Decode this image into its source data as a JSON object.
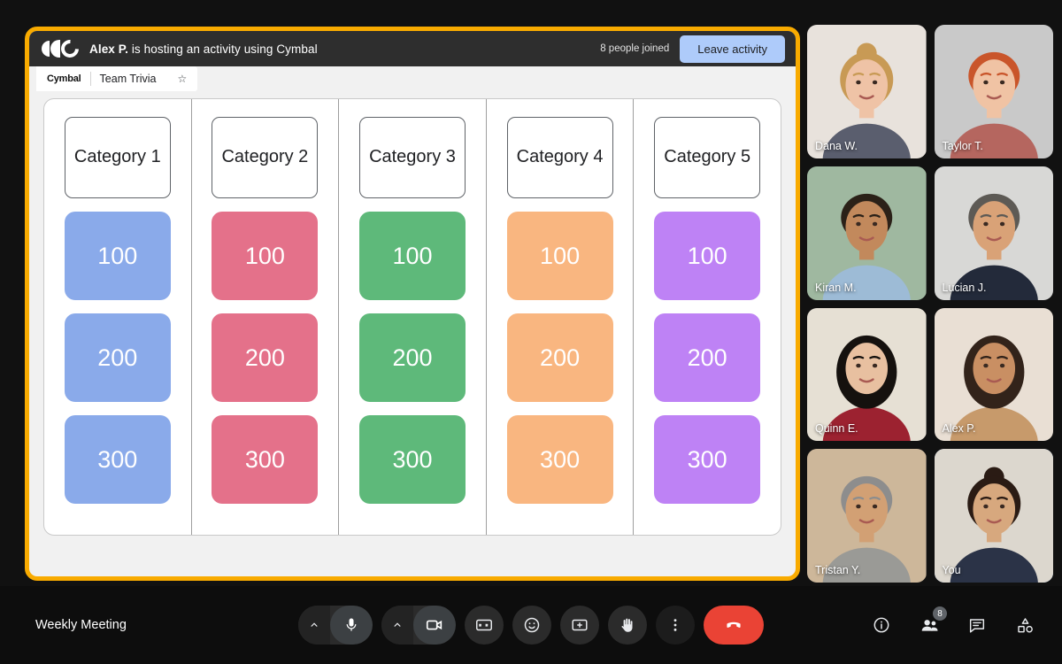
{
  "activity": {
    "logo_icon": "cymbal-logo-icon",
    "host_name": "Alex P.",
    "host_text": " is hosting an activity using Cymbal",
    "joined_count": "8 people joined",
    "leave_label": "Leave activity",
    "brand": "Cymbal",
    "tab_title": "Team Trivia",
    "star_icon": "☆"
  },
  "board": {
    "columns": [
      {
        "category": "Category 1",
        "color": "#8AAAEA",
        "tiles": [
          "100",
          "200",
          "300"
        ]
      },
      {
        "category": "Category 2",
        "color": "#E4718A",
        "tiles": [
          "100",
          "200",
          "300"
        ]
      },
      {
        "category": "Category 3",
        "color": "#5EB97A",
        "tiles": [
          "100",
          "200",
          "300"
        ]
      },
      {
        "category": "Category 4",
        "color": "#F9B680",
        "tiles": [
          "100",
          "200",
          "300"
        ]
      },
      {
        "category": "Category 5",
        "color": "#BE82F5",
        "tiles": [
          "100",
          "200",
          "300"
        ]
      }
    ]
  },
  "participants": [
    {
      "name": "Dana W.",
      "self": false
    },
    {
      "name": "Taylor T.",
      "self": false
    },
    {
      "name": "Kiran M.",
      "self": false
    },
    {
      "name": "Lucian J.",
      "self": false
    },
    {
      "name": "Quinn E.",
      "self": false
    },
    {
      "name": "Alex P.",
      "self": false
    },
    {
      "name": "Tristan Y.",
      "self": false
    },
    {
      "name": "You",
      "self": true
    }
  ],
  "bottom_bar": {
    "meeting_name": "Weekly Meeting",
    "controls": [
      {
        "name": "microphone-toggle",
        "icon": "microphone-icon"
      },
      {
        "name": "camera-toggle",
        "icon": "video-camera-icon"
      },
      {
        "name": "captions-toggle",
        "icon": "closed-captions-icon"
      },
      {
        "name": "reactions-button",
        "icon": "emoji-smiley-icon"
      },
      {
        "name": "present-screen-button",
        "icon": "present-screen-icon"
      },
      {
        "name": "raise-hand-button",
        "icon": "raised-hand-icon"
      },
      {
        "name": "more-options-button",
        "icon": "more-vertical-icon"
      },
      {
        "name": "end-call-button",
        "icon": "phone-hangup-icon"
      }
    ],
    "right_controls": [
      {
        "name": "meeting-details-button",
        "icon": "info-icon",
        "badge": ""
      },
      {
        "name": "people-panel-button",
        "icon": "people-icon",
        "badge": "8"
      },
      {
        "name": "chat-panel-button",
        "icon": "chat-icon",
        "badge": ""
      },
      {
        "name": "activities-panel-button",
        "icon": "activities-shapes-icon",
        "badge": ""
      }
    ]
  },
  "colors": {
    "accent_yellow": "#F9AB00",
    "leave_blue": "#AECBFA",
    "end_call_red": "#EA4335",
    "self_highlight": "#8AB4F8"
  }
}
